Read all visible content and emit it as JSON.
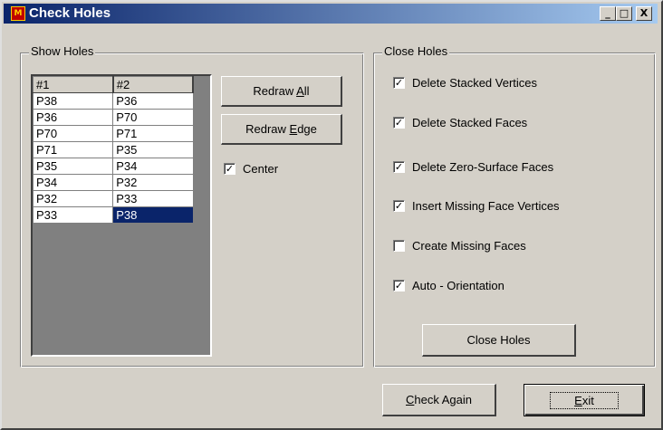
{
  "window": {
    "title": "Check Holes",
    "icon": "app-logo-icon",
    "controls": {
      "minimize": "_",
      "maximize": "□",
      "close": "X"
    }
  },
  "show_holes": {
    "label": "Show Holes",
    "columns": [
      "#1",
      "#2"
    ],
    "rows": [
      [
        "P38",
        "P36"
      ],
      [
        "P36",
        "P70"
      ],
      [
        "P70",
        "P71"
      ],
      [
        "P71",
        "P35"
      ],
      [
        "P35",
        "P34"
      ],
      [
        "P34",
        "P32"
      ],
      [
        "P32",
        "P33"
      ],
      [
        "P33",
        "P38"
      ]
    ],
    "selected_cell": {
      "row": 7,
      "col": 1
    },
    "redraw_all": {
      "pre": "Redraw ",
      "key": "A",
      "post": "ll"
    },
    "redraw_edge": {
      "pre": "Redraw ",
      "key": "E",
      "post": "dge"
    },
    "center": {
      "label": "Center",
      "checked": true
    }
  },
  "close_holes": {
    "label": "Close Holes",
    "options": [
      {
        "label": "Delete Stacked Vertices",
        "checked": true
      },
      {
        "label": "Delete Stacked Faces",
        "checked": true
      },
      {
        "label": "Delete Zero-Surface Faces",
        "checked": true
      },
      {
        "label": "Insert Missing Face Vertices",
        "checked": true
      },
      {
        "label": "Create Missing Faces",
        "checked": false
      },
      {
        "label": "Auto - Orientation",
        "checked": true
      }
    ],
    "button": "Close Holes"
  },
  "footer": {
    "check_again": {
      "key": "C",
      "post": "heck Again"
    },
    "exit": {
      "key": "E",
      "post": "xit"
    }
  }
}
